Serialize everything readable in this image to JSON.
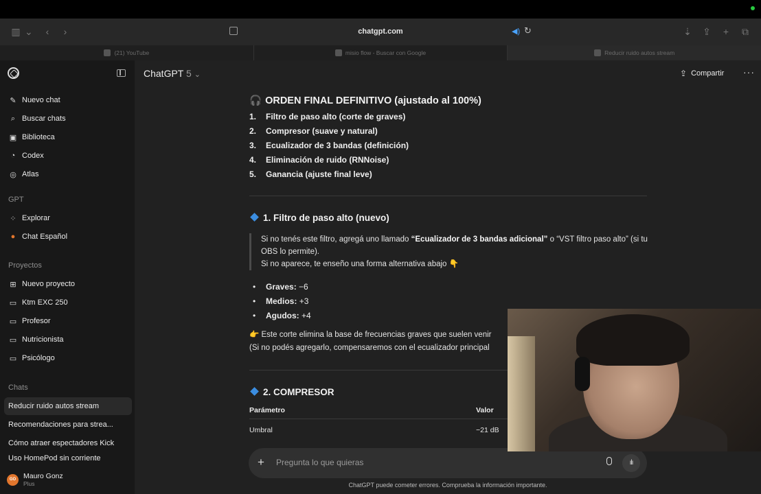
{
  "browser": {
    "url": "chatgpt.com",
    "tabs": [
      {
        "label": "(21) YouTube"
      },
      {
        "label": "misio flow - Buscar con Google"
      },
      {
        "label": "Reducir ruido autos stream"
      }
    ]
  },
  "sidebar": {
    "top_items": [
      {
        "label": "Nuevo chat",
        "icon": "edit-icon"
      },
      {
        "label": "Buscar chats",
        "icon": "search-icon"
      },
      {
        "label": "Biblioteca",
        "icon": "library-icon"
      },
      {
        "label": "Codex",
        "icon": "codex-icon"
      },
      {
        "label": "Atlas",
        "icon": "compass-icon"
      }
    ],
    "gpt_label": "GPT",
    "gpt_items": [
      {
        "label": "Explorar",
        "icon": "grid-icon"
      },
      {
        "label": "Chat Español",
        "icon": "gpt-avatar-icon"
      }
    ],
    "projects_label": "Proyectos",
    "projects": [
      {
        "label": "Nuevo proyecto",
        "icon": "new-folder-icon"
      },
      {
        "label": "Ktm EXC 250",
        "icon": "folder-icon"
      },
      {
        "label": "Profesor",
        "icon": "folder-icon"
      },
      {
        "label": "Nutricionista",
        "icon": "folder-icon"
      },
      {
        "label": "Psicólogo",
        "icon": "folder-icon"
      }
    ],
    "chats_label": "Chats",
    "chats": [
      {
        "label": "Reducir ruido autos stream",
        "active": true
      },
      {
        "label": "Recomendaciones para strea..."
      },
      {
        "label": "Cómo atraer espectadores Kick"
      },
      {
        "label": "Uso HomePod sin corriente"
      }
    ],
    "user": {
      "initials": "GO",
      "name": "Mauro Gonz",
      "plan": "Plus"
    }
  },
  "header": {
    "model_name": "ChatGPT",
    "model_version": "5",
    "share_label": "Compartir"
  },
  "message": {
    "final_heading": "ORDEN FINAL DEFINITIVO (ajustado al 100%)",
    "final_heading_emoji": "🎧",
    "order": [
      {
        "num": "1.",
        "text": "Filtro de paso alto (corte de graves)"
      },
      {
        "num": "2.",
        "text": "Compresor (suave y natural)"
      },
      {
        "num": "3.",
        "text": "Ecualizador de 3 bandas (definición)"
      },
      {
        "num": "4.",
        "text": "Eliminación de ruido (RNNoise)"
      },
      {
        "num": "5.",
        "text": "Ganancia (ajuste final leve)"
      }
    ],
    "section1_title": "1. Filtro de paso alto (nuevo)",
    "quote_line1_pre": "Si no tenés este filtro, agregá uno llamado ",
    "quote_line1_bold": "“Ecualizador de 3 bandas adicional”",
    "quote_line1_post": " o “VST filtro paso alto” (si tu OBS lo permite).",
    "quote_line2": "Si no aparece, te enseño una forma alternativa abajo 👇",
    "bullets": [
      {
        "label": "Graves:",
        "value": "−6"
      },
      {
        "label": "Medios:",
        "value": "+3"
      },
      {
        "label": "Agudos:",
        "value": "+4"
      }
    ],
    "para1": "👉 Este corte elimina la base de frecuencias graves que suelen venir",
    "para2": "(Si no podés agregarlo, compensaremos con el ecualizador principal",
    "section2_title": "2. COMPRESOR",
    "table": {
      "headers": [
        "Parámetro",
        "Valor"
      ],
      "rows": [
        [
          "Umbral",
          "−21 dB"
        ]
      ]
    }
  },
  "composer": {
    "placeholder": "Pregunta lo que quieras",
    "disclaimer": "ChatGPT puede cometer errores. Comprueba la información importante."
  },
  "colors": {
    "accent_diamond": "#3b8de0",
    "main_bg": "#212121",
    "sidebar_bg": "#181818"
  }
}
